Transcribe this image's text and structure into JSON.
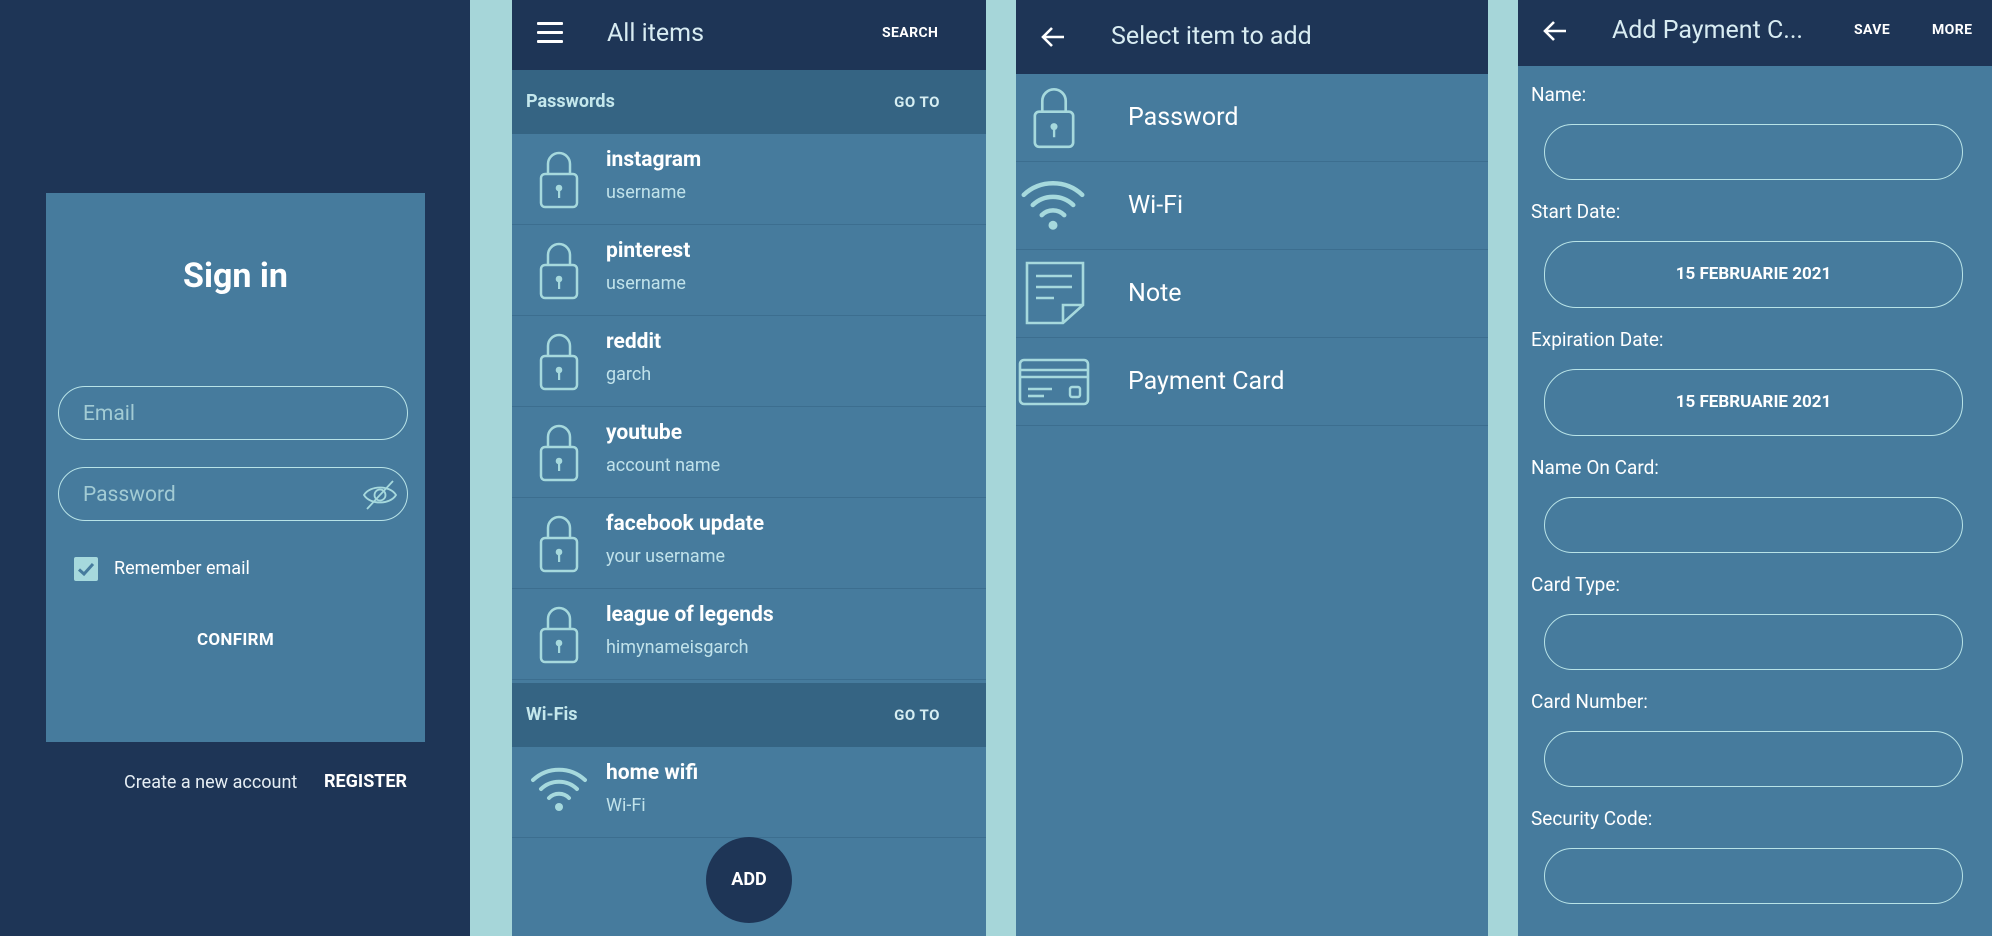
{
  "colors": {
    "gutter": "#a6d6d9",
    "dark_navy": "#1e3556",
    "panel_blue": "#467b9d",
    "section_header": "#356483",
    "accent_light": "#a6d9dd"
  },
  "sign_in": {
    "title": "Sign in",
    "email_placeholder": "Email",
    "password_placeholder": "Password",
    "password_toggle_icon": "eye-off-icon",
    "remember_label": "Remember email",
    "remember_checked": true,
    "confirm_label": "CONFIRM",
    "create_account_text": "Create a new account",
    "register_label": "REGISTER"
  },
  "all_items": {
    "menu_icon": "hamburger-icon",
    "title": "All items",
    "search_label": "SEARCH",
    "sections": [
      {
        "title": "Passwords",
        "goto_label": "GO TO",
        "items": [
          {
            "name": "instagram",
            "sub": "username",
            "icon": "lock-icon"
          },
          {
            "name": "pinterest",
            "sub": "username",
            "icon": "lock-icon"
          },
          {
            "name": "reddit",
            "sub": "garch",
            "icon": "lock-icon"
          },
          {
            "name": "youtube",
            "sub": "account name",
            "icon": "lock-icon"
          },
          {
            "name": "facebook update",
            "sub": "your username",
            "icon": "lock-icon"
          },
          {
            "name": "league of legends",
            "sub": "himynameisgarch",
            "icon": "lock-icon"
          }
        ]
      },
      {
        "title": "Wi-Fis",
        "goto_label": "GO TO",
        "items": [
          {
            "name": "home wifi",
            "sub": "Wi-Fi",
            "icon": "wifi-icon"
          }
        ]
      }
    ],
    "add_label": "ADD"
  },
  "select_item": {
    "back_icon": "back-arrow-icon",
    "title": "Select item to add",
    "options": [
      {
        "label": "Password",
        "icon": "lock-icon"
      },
      {
        "label": "Wi-Fi",
        "icon": "wifi-icon"
      },
      {
        "label": "Note",
        "icon": "note-icon"
      },
      {
        "label": "Payment Card",
        "icon": "credit-card-icon"
      }
    ]
  },
  "payment_card": {
    "back_icon": "back-arrow-icon",
    "title": "Add Payment C...",
    "save_label": "SAVE",
    "more_label": "MORE",
    "fields": [
      {
        "label": "Name:",
        "value": ""
      },
      {
        "label": "Start Date:",
        "value": "15 FEBRUARIE 2021"
      },
      {
        "label": "Expiration Date:",
        "value": "15 FEBRUARIE 2021"
      },
      {
        "label": "Name On Card:",
        "value": ""
      },
      {
        "label": "Card Type:",
        "value": ""
      },
      {
        "label": "Card Number:",
        "value": ""
      },
      {
        "label": "Security Code:",
        "value": ""
      }
    ]
  }
}
